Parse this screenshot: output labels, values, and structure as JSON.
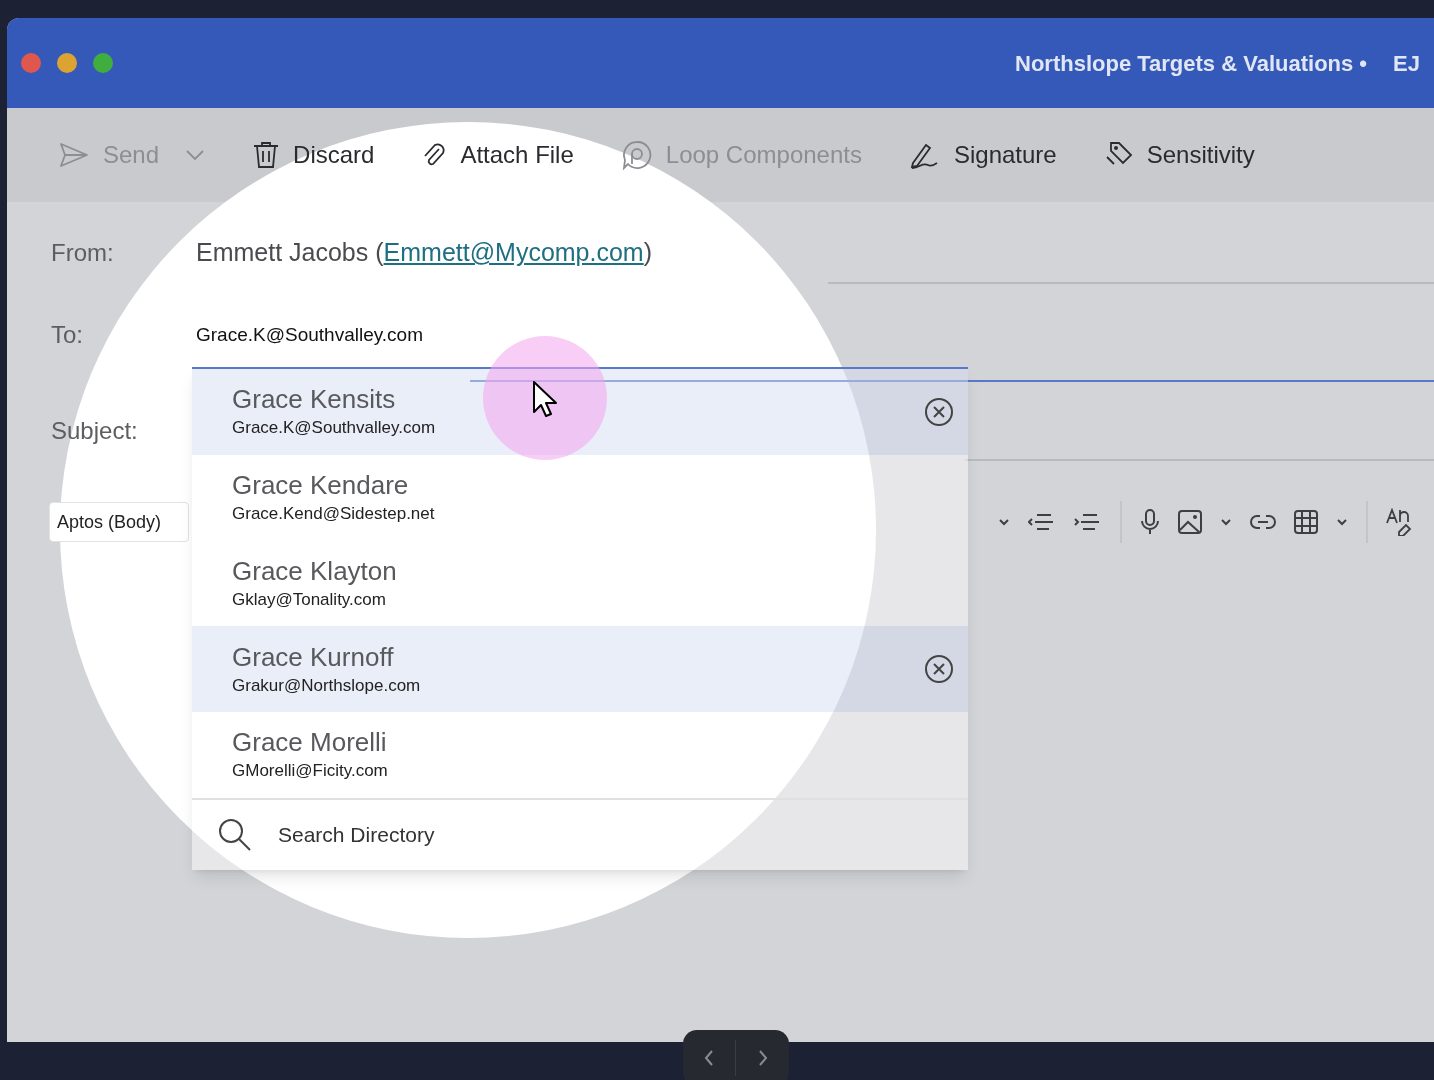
{
  "window": {
    "title": "Northslope Targets & Valuations •",
    "account": "EJ"
  },
  "toolbar": [
    {
      "kind": "send",
      "label": "Send",
      "disabled": true
    },
    {
      "kind": "discard",
      "label": "Discard",
      "disabled": false
    },
    {
      "kind": "attach",
      "label": "Attach File",
      "disabled": false
    },
    {
      "kind": "loop",
      "label": "Loop Components",
      "disabled": true
    },
    {
      "kind": "signature",
      "label": "Signature",
      "disabled": false
    },
    {
      "kind": "sensitivity",
      "label": "Sensitivity",
      "disabled": false
    }
  ],
  "from": {
    "label": "From:",
    "prefix": "Emmett Jacobs (",
    "email": "Emmett@Mycomp.com",
    "suffix": ")"
  },
  "to": {
    "label": "To:",
    "value": "Grace.K@Southvalley.com"
  },
  "subject": {
    "label": "Subject:"
  },
  "format_bar": {
    "font": "Aptos (Body)"
  },
  "suggestions": [
    {
      "name": "Grace Kensits",
      "email": "Grace.K@Southvalley.com",
      "highlighted": true,
      "removable": true
    },
    {
      "name": "Grace Kendare",
      "email": "Grace.Kend@Sidestep.net",
      "highlighted": false,
      "removable": false
    },
    {
      "name": "Grace Klayton",
      "email": "Gklay@Tonality.com",
      "highlighted": false,
      "removable": false
    },
    {
      "name": "Grace Kurnoff",
      "email": "Grakur@Northslope.com",
      "highlighted": true,
      "removable": true
    },
    {
      "name": "Grace Morelli",
      "email": "GMorelli@Ficity.com",
      "highlighted": false,
      "removable": false
    }
  ],
  "search_directory": "Search Directory"
}
